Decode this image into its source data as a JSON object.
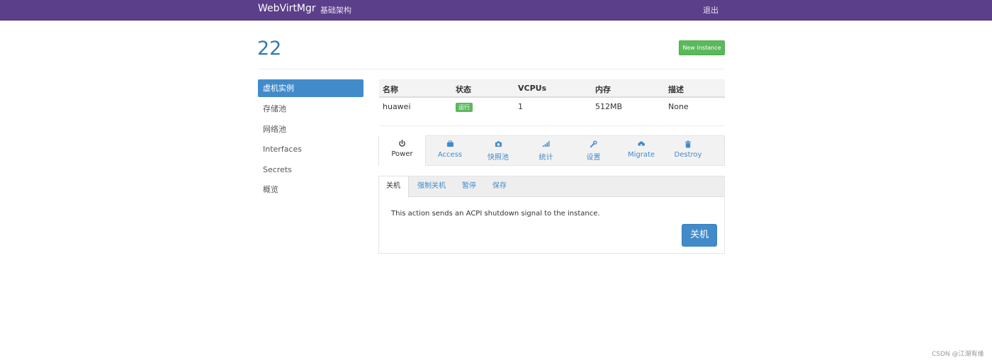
{
  "navbar": {
    "brand": "WebVirtMgr",
    "infrastructure": "基础架构",
    "logout": "退出"
  },
  "header": {
    "title": "22",
    "new_instance_label": "New Instance"
  },
  "sidebar": {
    "items": [
      {
        "label": "虚机实例",
        "active": true
      },
      {
        "label": "存储池"
      },
      {
        "label": "网络池"
      },
      {
        "label": "Interfaces"
      },
      {
        "label": "Secrets"
      },
      {
        "label": "概览"
      }
    ]
  },
  "table": {
    "headers": [
      "名称",
      "状态",
      "VCPUs",
      "内存",
      "描述"
    ],
    "rows": [
      {
        "name": "huawei",
        "status": "运行",
        "vcpus": "1",
        "memory": "512MB",
        "description": "None"
      }
    ]
  },
  "action_tabs": [
    {
      "label": "Power",
      "icon": "power-icon",
      "active": true
    },
    {
      "label": "Access",
      "icon": "briefcase-icon"
    },
    {
      "label": "快照池",
      "icon": "camera-icon"
    },
    {
      "label": "统计",
      "icon": "signal-icon"
    },
    {
      "label": "设置",
      "icon": "wrench-icon"
    },
    {
      "label": "Migrate",
      "icon": "cloud-upload-icon"
    },
    {
      "label": "Destroy",
      "icon": "trash-icon"
    }
  ],
  "power_tabs": [
    {
      "label": "关机",
      "active": true
    },
    {
      "label": "强制关机"
    },
    {
      "label": "暂停"
    },
    {
      "label": "保存"
    }
  ],
  "power_panel": {
    "description": "This action sends an ACPI shutdown signal to the instance.",
    "button_label": "关机"
  },
  "watermark": "CSDN @江湖有缘",
  "colors": {
    "navbar": "#5b3f8a",
    "primary": "#428bca",
    "success": "#5cb85c"
  }
}
